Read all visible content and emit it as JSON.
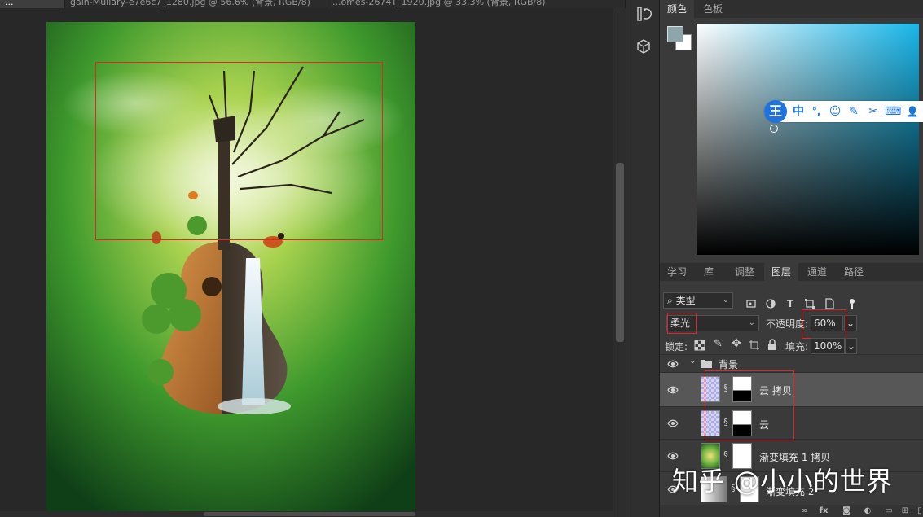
{
  "tabs": [
    {
      "label": "...",
      "active": true
    },
    {
      "label": "gain-Mullary-e7e6c7_1280.jpg @ 56.6% (背景, RGB/8)",
      "active": false
    },
    {
      "label": "...omes-2674T_1920.jpg @ 33.3% (背景, RGB/8)",
      "active": false
    }
  ],
  "color_panel": {
    "tabs": [
      "颜色",
      "色板"
    ],
    "foreground": "#8fa5ac",
    "background": "#ffffff"
  },
  "ime": {
    "logo": "王",
    "items": [
      "中",
      "°,",
      "☺",
      "✎",
      "✂",
      "⌨",
      "👤"
    ]
  },
  "layers_panel": {
    "tabs": [
      "学习",
      "库",
      "调整",
      "图层",
      "通道",
      "路径"
    ],
    "active_tab": "图层",
    "filter_label": "类型",
    "blend_mode": "柔光",
    "opacity_label": "不透明度:",
    "opacity_value": "60%",
    "lock_label": "锁定:",
    "fill_label": "填充:",
    "fill_value": "100%",
    "layers": [
      {
        "name": "背景",
        "type": "group",
        "expanded": true
      },
      {
        "name": "云 拷贝",
        "type": "layer",
        "selected": true
      },
      {
        "name": "云",
        "type": "layer",
        "selected": false
      },
      {
        "name": "渐变填充 1 拷贝",
        "type": "fill",
        "selected": false
      },
      {
        "name": "渐变填充 2",
        "type": "fill",
        "selected": false
      }
    ]
  },
  "watermark": "知乎 @小小的世界",
  "bottom_icons": [
    "link-icon",
    "fx-icon",
    "mask-icon",
    "adjustment-icon",
    "folder-icon",
    "new-layer-icon",
    "trash-icon"
  ]
}
